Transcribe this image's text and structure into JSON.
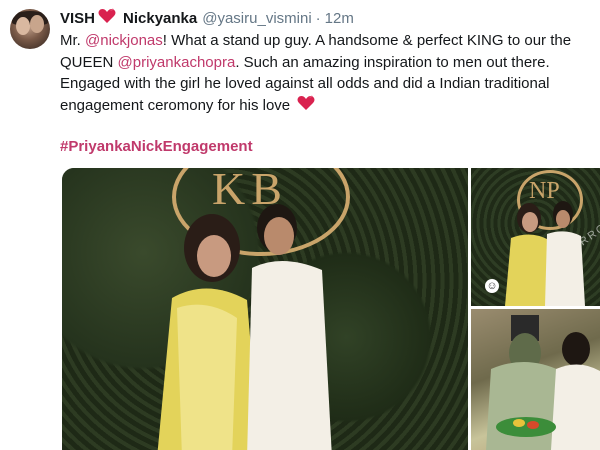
{
  "tweet": {
    "display_name": "VISH",
    "display_name_emoji": "heart-emoji",
    "second_name": "Nickyanka",
    "handle": "@yasiru_vismini",
    "separator": "·",
    "time": "12m",
    "body": {
      "line1_a": "Mr. ",
      "mention1": "@nickjonas",
      "line1_b": "! What a stand up guy. A handsome & perfect KING to our the QUEEN ",
      "mention2": "@priyankachopra",
      "line1_c": ". Such an amazing inspiration to men out there. Engaged with the girl he loved against all odds and did a Indian traditional engagement ceromony for his love ",
      "hashtag": "#PriyankaNickEngagement"
    },
    "media": {
      "main_monogram": "KB",
      "side_monogram": "NP",
      "side_watermark": "MUMBAI MIRROR",
      "side_smiley": "☺"
    }
  },
  "colors": {
    "link": "#c0396b",
    "muted": "#657786",
    "text": "#14171a",
    "heart": "#d9224f",
    "gold": "#c9a46a"
  }
}
